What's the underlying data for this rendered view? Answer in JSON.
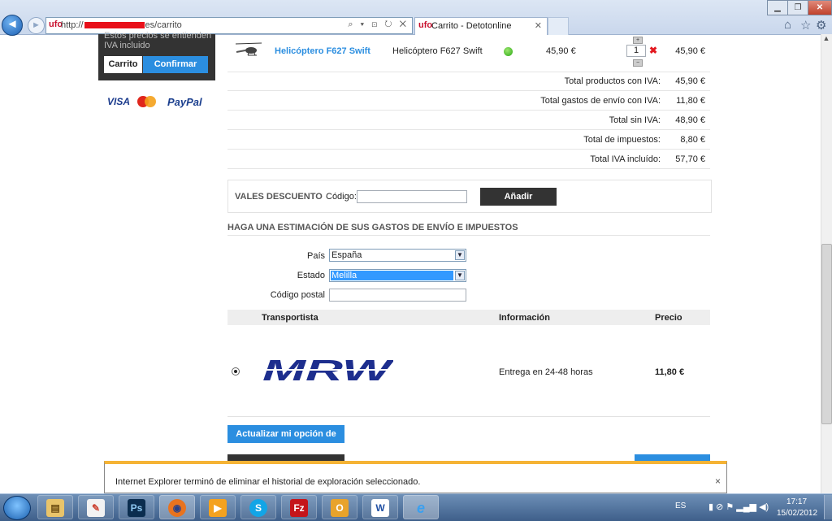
{
  "browser": {
    "url_prefix": "http://",
    "url_suffix": "es/carrito",
    "address_tools": "⌕ ▾ ⊡ ↻ ✕",
    "tab_title": "Carrito - Detotonline",
    "tab_favicon": "ufo",
    "icons": [
      "back-arrow-icon",
      "forward-arrow-icon",
      "home-icon",
      "star-icon",
      "gear-icon"
    ]
  },
  "sidebar": {
    "prices_note": "Estos precios se entienden IVA incluido",
    "cart_button": "Carrito",
    "confirm_button": "Confirmar",
    "payments": [
      "VISA",
      "MasterCard",
      "PayPal"
    ]
  },
  "cart": {
    "product": {
      "name_link": "Helicóptero F627 Swift",
      "description": "Helicóptero F627 Swift",
      "availability_color": "#2ca814",
      "unit_price": "45,90 €",
      "quantity": "1",
      "qty_plus": "+",
      "qty_minus": "−",
      "delete_icon": "✖",
      "total": "45,90 €"
    },
    "totals": [
      {
        "label": "Total productos con IVA:",
        "value": "45,90 €"
      },
      {
        "label": "Total gastos de envío con IVA:",
        "value": "11,80 €"
      },
      {
        "label": "Total sin IVA:",
        "value": "48,90 €"
      },
      {
        "label": "Total de impuestos:",
        "value": "8,80 €"
      },
      {
        "label": "Total IVA incluído:",
        "value": "57,70 €"
      }
    ]
  },
  "discount": {
    "title": "VALES DESCUENTO",
    "code_label": "Código:",
    "code_value": "",
    "add_button": "Añadir"
  },
  "shipping": {
    "title": "HAGA UNA ESTIMACIÓN DE SUS GASTOS DE ENVÍO E IMPUESTOS",
    "country_label": "País",
    "country_value": "España",
    "state_label": "Estado",
    "state_value": "Melilla",
    "postal_label": "Código postal",
    "postal_value": "",
    "headers": {
      "carrier": "Transportista",
      "info": "Información",
      "price": "Precio"
    },
    "carrier": {
      "logo_text": "MRW",
      "info": "Entrega en 24-48 horas",
      "price": "11,80 €",
      "selected": true
    },
    "update_button": "Actualizar mi opción de envío"
  },
  "notification": {
    "message": "Internet Explorer terminó de eliminar el historial de exploración seleccionado.",
    "close": "×"
  },
  "taskbar": {
    "apps": [
      {
        "name": "windows-explorer",
        "glyph": "▤"
      },
      {
        "name": "paint",
        "glyph": "✎"
      },
      {
        "name": "photoshop",
        "glyph": "Ps"
      },
      {
        "name": "firefox",
        "glyph": "◉"
      },
      {
        "name": "media-player",
        "glyph": "▶"
      },
      {
        "name": "skype",
        "glyph": "S"
      },
      {
        "name": "filezilla",
        "glyph": "Fz"
      },
      {
        "name": "outlook",
        "glyph": "O"
      },
      {
        "name": "word",
        "glyph": "W"
      },
      {
        "name": "internet-explorer",
        "glyph": "e"
      }
    ],
    "language": "ES",
    "time": "17:17",
    "date": "15/02/2012"
  }
}
